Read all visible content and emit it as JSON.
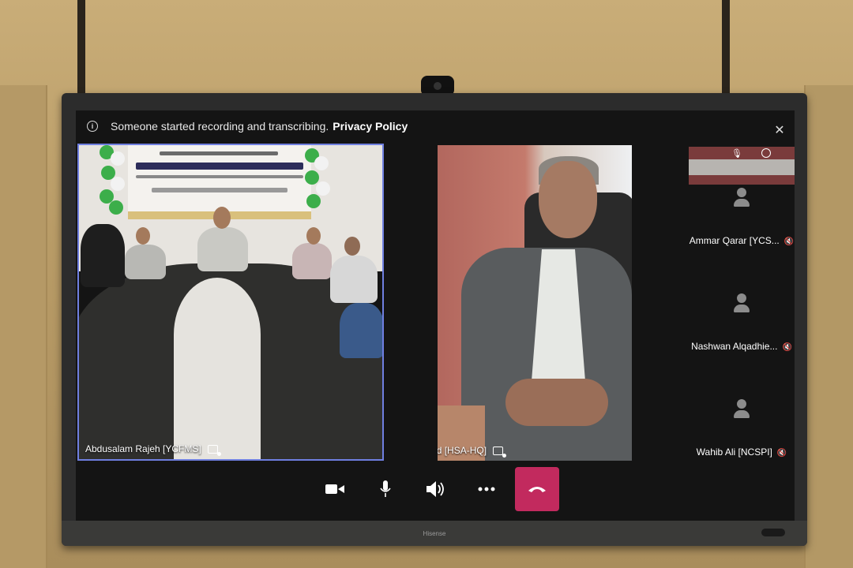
{
  "banner": {
    "message": "Someone started recording and transcribing.",
    "link": "Privacy Policy"
  },
  "close_label": "✕",
  "tiles": [
    {
      "name": "Abdusalam Rajeh [YCFMS]"
    },
    {
      "name": "Nabil Saeed [HSA-HQ]"
    }
  ],
  "participants": [
    {
      "name": "Ammar Qarar [YCS..."
    },
    {
      "name": "Nashwan Alqadhie..."
    },
    {
      "name": "Wahib Ali [NCSPI]"
    }
  ],
  "controls": [
    "camera-icon",
    "microphone-icon",
    "speaker-icon",
    "more-icon",
    "hang-up-icon"
  ],
  "monitor_brand": "Hisense",
  "colors": {
    "hangup": "#c22a5e",
    "active_border": "#6f7fe0"
  }
}
